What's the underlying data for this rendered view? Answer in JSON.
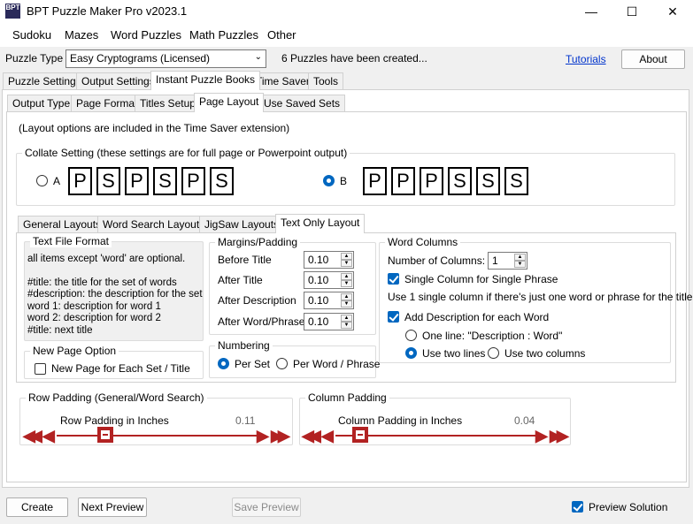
{
  "window": {
    "title": "BPT Puzzle Maker Pro v2023.1",
    "icon_text": "BPT",
    "minimize": "—",
    "maximize": "☐",
    "close": "✕"
  },
  "menu": [
    "Sudoku",
    "Mazes",
    "Word Puzzles",
    "Math Puzzles",
    "Other"
  ],
  "toolbar": {
    "puzzle_type_label": "Puzzle Type",
    "puzzle_type_value": "Easy Cryptograms (Licensed)",
    "status": "6 Puzzles have been created...",
    "tutorials": "Tutorials",
    "about": "About"
  },
  "main_tabs": [
    "Puzzle Settings",
    "Output Settings",
    "Instant Puzzle Books",
    "Time Saver",
    "Tools"
  ],
  "sub_tabs": [
    "Output Type",
    "Page Format",
    "Titles Setup",
    "Page Layout",
    "Use Saved Sets"
  ],
  "layout_note": "(Layout options are included in the Time Saver extension)",
  "collate": {
    "title": "Collate Setting (these settings are for full page or Powerpoint output)",
    "option_a": "A",
    "option_b": "B",
    "letters_a": [
      "P",
      "S",
      "P",
      "S",
      "P",
      "S"
    ],
    "letters_b": [
      "P",
      "P",
      "P",
      "S",
      "S",
      "S"
    ],
    "selected": "B"
  },
  "layout_tabs": [
    "General Layouts",
    "Word Search Layouts",
    "JigSaw Layouts",
    "Text Only Layout"
  ],
  "text_file_format": {
    "title": "Text File Format",
    "lines": [
      "all items except 'word' are optional.",
      "",
      "#title: the title for the set of words",
      "#description: the description for the set",
      "word 1: description for word 1",
      "word 2: description for word 2",
      "#title: next title"
    ]
  },
  "new_page": {
    "title": "New Page Option",
    "label": "New Page for Each Set / Title",
    "checked": false
  },
  "margins": {
    "title": "Margins/Padding",
    "rows": [
      {
        "label": "Before Title",
        "value": "0.10"
      },
      {
        "label": "After Title",
        "value": "0.10"
      },
      {
        "label": "After Description",
        "value": "0.10"
      },
      {
        "label": "After Word/Phrase",
        "value": "0.10"
      }
    ]
  },
  "numbering": {
    "title": "Numbering",
    "per_set": "Per Set",
    "per_word": "Per Word / Phrase",
    "selected": "Per Set"
  },
  "word_columns": {
    "title": "Word Columns",
    "num_columns_label": "Number of Columns:",
    "num_columns_value": "1",
    "single_column_label": "Single Column for Single Phrase",
    "single_column_checked": true,
    "hint": "Use 1 single column if there's just one word or phrase for the title",
    "add_desc_label": "Add Description for each Word",
    "add_desc_checked": true,
    "one_line": "One line: \"Description : Word\"",
    "two_lines": "Use two lines",
    "two_columns": "Use two columns",
    "selected": "Use two lines"
  },
  "row_padding": {
    "title": "Row Padding (General/Word Search)",
    "label": "Row Padding in Inches",
    "value": "0.11",
    "fraction": 0.11
  },
  "column_padding": {
    "title": "Column Padding",
    "label": "Column Padding in Inches",
    "value": "0.04",
    "fraction": 0.04
  },
  "bottom": {
    "create": "Create",
    "next_preview": "Next Preview",
    "save_preview": "Save Preview",
    "preview_solution": "Preview Solution",
    "preview_solution_checked": true
  },
  "colors": {
    "accent": "#0067c0",
    "slider": "#b22222"
  }
}
